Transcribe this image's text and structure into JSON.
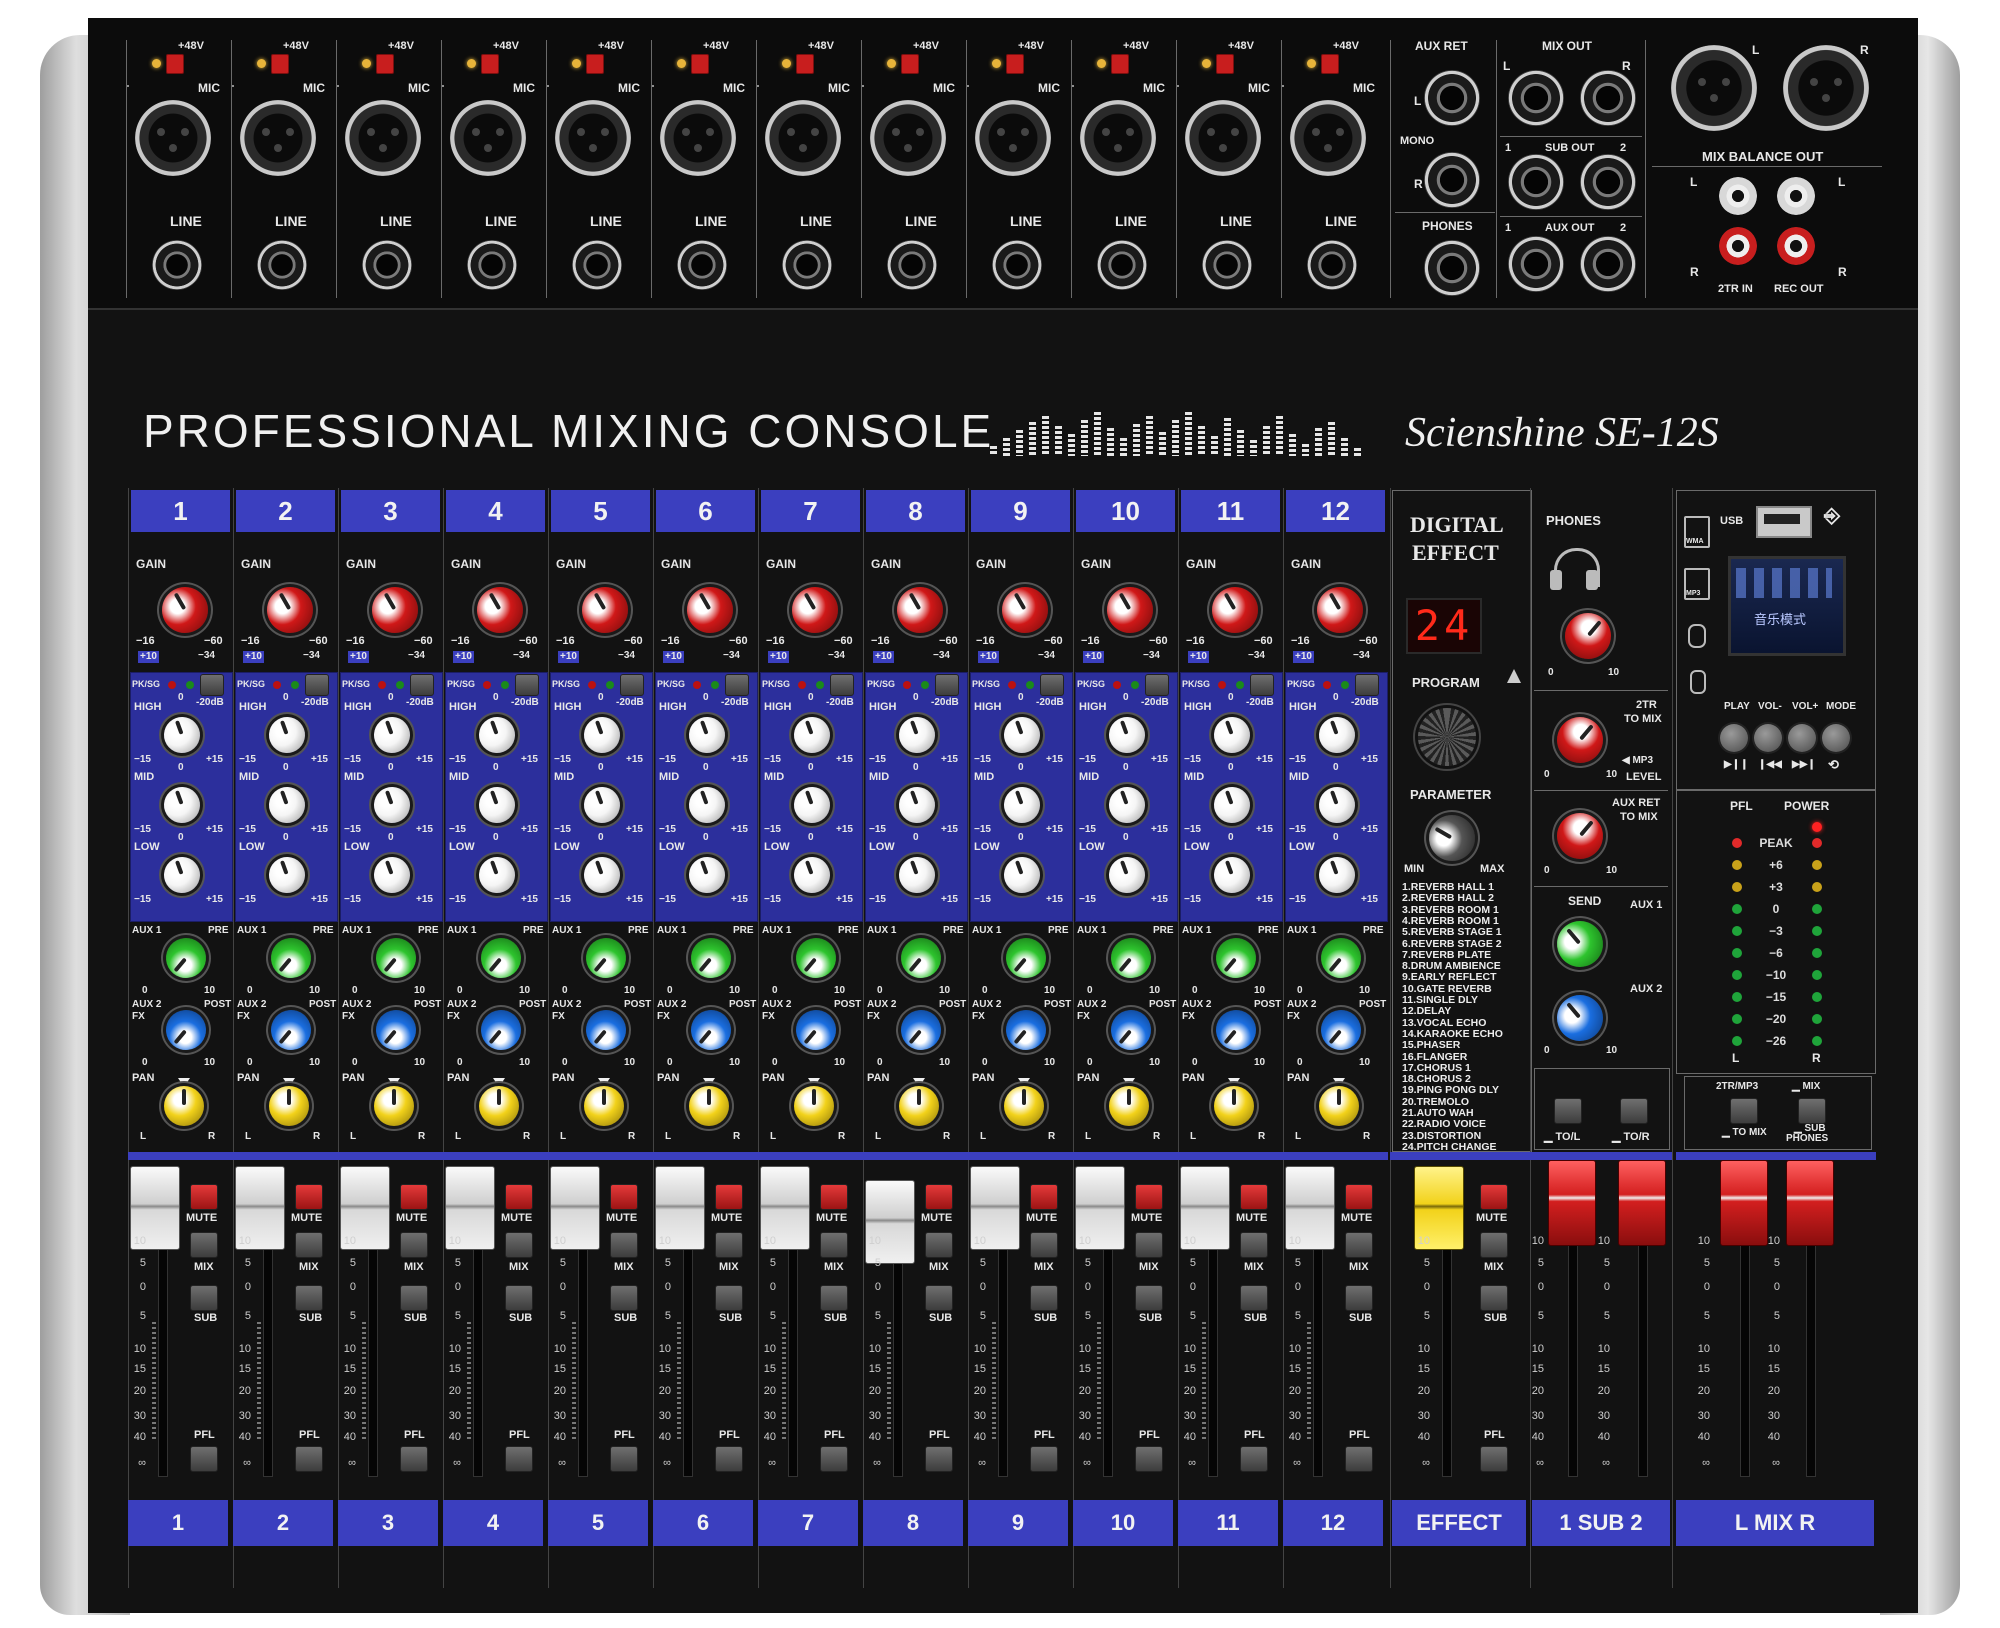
{
  "console": {
    "title": "PROFESSIONAL MIXING CONSOLE",
    "brand": "Scienshine SE-12S"
  },
  "colors": {
    "body": "#111111",
    "side_panel": "#bdbdbd",
    "channel_blue": "#3b3fbf",
    "eq_panel": "#2c2f9c",
    "led_red": "#d82020",
    "knob_red": "#d01818",
    "knob_green": "#2ec42e",
    "knob_blue": "#1a6ee0",
    "knob_yellow": "#f2d21a",
    "fader_white": "#e8e8e8",
    "fader_yellow": "#f2d21a",
    "fader_red": "#d31f1f"
  },
  "inputs": {
    "phantom_label": "+48V",
    "mic_label": "MIC",
    "line_label": "LINE"
  },
  "io": {
    "aux_ret": "AUX RET",
    "mono": "MONO",
    "phones": "PHONES",
    "mix_out": "MIX OUT",
    "sub_out": "SUB OUT",
    "aux_out": "AUX OUT",
    "mix_balance_out": "MIX BALANCE OUT",
    "tr_in": "2TR IN",
    "rec_out": "REC OUT",
    "l": "L",
    "r": "R",
    "one": "1",
    "two": "2"
  },
  "strip": {
    "gain": "GAIN",
    "gain_min": "−16",
    "gain_max": "−60",
    "gain_pad_lo": "+10",
    "gain_pad_hi": "−34",
    "pksig": "PK/SG",
    "pad": "-20dB",
    "high": "HIGH",
    "mid": "MID",
    "low": "LOW",
    "eq_min": "−15",
    "eq_zero": "0",
    "eq_max": "+15",
    "aux1": "AUX 1",
    "pre": "PRE",
    "aux2fx": "AUX 2\nFX",
    "post": "POST",
    "zero": "0",
    "ten": "10",
    "pan": "PAN",
    "l": "L",
    "r": "R",
    "mute": "MUTE",
    "mix": "MIX",
    "sub": "SUB",
    "pfl": "PFL"
  },
  "channels": [
    "1",
    "2",
    "3",
    "4",
    "5",
    "6",
    "7",
    "8",
    "9",
    "10",
    "11",
    "12"
  ],
  "fader_scale": [
    "10",
    "5",
    "0",
    "5",
    "10",
    "15",
    "20",
    "30",
    "40",
    "∞"
  ],
  "effect": {
    "title_line1": "DIGITAL",
    "title_line2": "EFFECT",
    "display": "24",
    "program": "PROGRAM",
    "parameter": "PARAMETER",
    "min": "MIN",
    "max": "MAX",
    "list": [
      "1.REVERB HALL 1",
      "2.REVERB HALL 2",
      "3.REVERB ROOM 1",
      "4.REVERB ROOM 1",
      "5.REVERB STAGE 1",
      "6.REVERB STAGE 2",
      "7.REVERB PLATE",
      "8.DRUM AMBIENCE",
      "9.EARLY REFLECT",
      "10.GATE REVERB",
      "11.SINGLE DLY",
      "12.DELAY",
      "13.VOCAL ECHO",
      "14.KARAOKE ECHO",
      "15.PHASER",
      "16.FLANGER",
      "17.CHORUS 1",
      "18.CHORUS 2",
      "19.PING PONG DLY",
      "20.TREMOLO",
      "21.AUTO WAH",
      "22.RADIO VOICE",
      "23.DISTORTION",
      "24.PITCH CHANGE"
    ],
    "mute": "MUTE",
    "mix": "MIX",
    "sub": "SUB",
    "pfl": "PFL"
  },
  "master": {
    "phones": "PHONES",
    "tr_to_mix_1": "2TR",
    "tr_to_mix_2": "TO MIX",
    "mp3": "◀ MP3",
    "level": "LEVEL",
    "aux_ret_1": "AUX RET",
    "aux_ret_2": "TO MIX",
    "send": "SEND",
    "aux1": "AUX 1",
    "aux2": "AUX 2",
    "zero": "0",
    "ten": "10",
    "to_l": "▁ TO/L",
    "to_r": "▁ TO/R"
  },
  "player": {
    "usb": "USB",
    "wma": "WMA",
    "mp3": "MP3",
    "screen_text": "音乐模式",
    "play": "PLAY",
    "vol_minus": "VOL-",
    "vol_plus": "VOL+",
    "mode": "MODE",
    "play_icon": "▶❙❙",
    "prev_icon": "❙◀◀",
    "next_icon": "▶▶❙",
    "mode_icon": "⟲"
  },
  "meter": {
    "pfl": "PFL",
    "power": "POWER",
    "rows": [
      "PEAK",
      "+6",
      "+3",
      "0",
      "−3",
      "−6",
      "−10",
      "−15",
      "−20",
      "−26"
    ],
    "l": "L",
    "r": "R"
  },
  "routing": {
    "tr_mp3": "2TR/MP3",
    "to_mix_label": "▁ TO MIX",
    "mix": "▁ MIX",
    "sub": "▁ SUB",
    "phones": "PHONES"
  },
  "bottom_labels": {
    "effect": "EFFECT",
    "sub": "1 SUB 2",
    "mix": "L MIX R"
  }
}
